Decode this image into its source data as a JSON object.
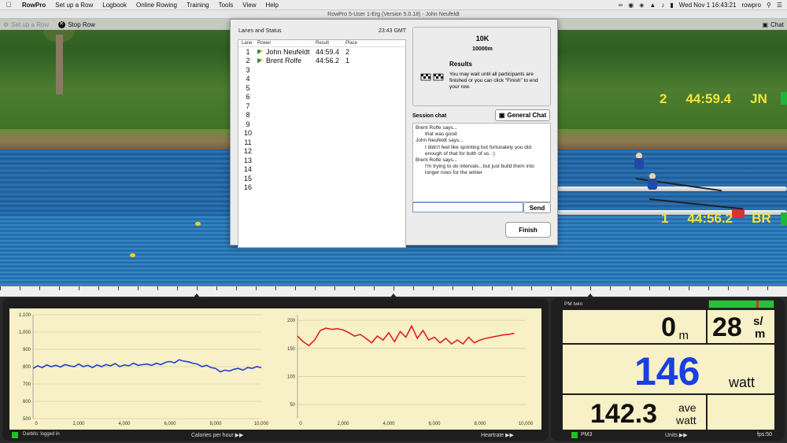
{
  "menubar": {
    "app": "RowPro",
    "items": [
      "Set up a Row",
      "Logbook",
      "Online Rowing",
      "Training",
      "Tools",
      "View",
      "Help"
    ],
    "clock": "Wed Nov 1  16:43:21",
    "user": "rowpro"
  },
  "window": {
    "title": "RowPro 5-User 1-Erg (Version 5.0.18) - John Neufeldt"
  },
  "toolbar": {
    "setup": "Set up a Row",
    "stop": "Stop Row",
    "chat": "Chat"
  },
  "overlay": {
    "lane2": {
      "lane": "2",
      "time": "44:59.4",
      "initials": "JN"
    },
    "lane1": {
      "lane": "1",
      "time": "44:56.2",
      "initials": "BR"
    }
  },
  "dialog": {
    "heading": "Lanes and Status",
    "time": "23:43 GMT",
    "columns": [
      "Lane",
      "Rower",
      "Result",
      "Place"
    ],
    "lanes": [
      {
        "lane": "1",
        "rower": "John Neufeldt",
        "result": "44:59.4",
        "place": "2"
      },
      {
        "lane": "2",
        "rower": "Brent Rolfe",
        "result": "44:56.2",
        "place": "1"
      },
      {
        "lane": "3"
      },
      {
        "lane": "4"
      },
      {
        "lane": "5"
      },
      {
        "lane": "6"
      },
      {
        "lane": "7"
      },
      {
        "lane": "8"
      },
      {
        "lane": "9"
      },
      {
        "lane": "10"
      },
      {
        "lane": "11"
      },
      {
        "lane": "12"
      },
      {
        "lane": "13"
      },
      {
        "lane": "14"
      },
      {
        "lane": "15"
      },
      {
        "lane": "16"
      }
    ],
    "event": "10K",
    "distance": "10000m",
    "results_title": "Results",
    "results_text": "You may wait until all participants are finished or you can click \"Finish\" to end your row.",
    "session_chat_label": "Session chat",
    "general_chat_label": "General Chat",
    "chat": [
      {
        "who": "Brent Rolfe says...",
        "msg": "that was good"
      },
      {
        "who": "John Neufeldt says...",
        "msg": "I didn't feel like sprinting but fortunately you did enough of that for both of us. :)"
      },
      {
        "who": "Brent Rolfe says...",
        "msg": "I'm trying to do intervals...but just build them into longer rows for the winter"
      }
    ],
    "send_label": "Send",
    "finish_label": "Finish"
  },
  "graphs": {
    "darbits": "Darbits: logged in",
    "left_label": "Calories per hour",
    "right_label": "Heartrate",
    "left_y_ticks": [
      "1,100",
      "1,000",
      "900",
      "800",
      "700",
      "600",
      "500"
    ],
    "left_x_ticks": [
      "0",
      "2,000",
      "4,000",
      "6,000",
      "8,000",
      "10,000"
    ],
    "right_y_ticks": [
      "200",
      "150",
      "100",
      "50"
    ],
    "right_x_ticks": [
      "0",
      "2,000",
      "4,000",
      "6,000",
      "8,000",
      "10,000"
    ]
  },
  "chart_data": [
    {
      "type": "line",
      "title": "Calories per hour",
      "x": [
        0,
        200,
        400,
        600,
        800,
        1000,
        1200,
        1400,
        1600,
        1800,
        2000,
        2200,
        2400,
        2600,
        2800,
        3000,
        3200,
        3400,
        3600,
        3800,
        4000,
        4200,
        4400,
        4600,
        4800,
        5000,
        5200,
        5400,
        5600,
        5800,
        6000,
        6200,
        6400,
        6600,
        6800,
        7000,
        7200,
        7400,
        7600,
        7800,
        8000,
        8200,
        8400,
        8600,
        8800,
        9000,
        9200,
        9400,
        9600,
        9800,
        10000
      ],
      "series": [
        {
          "values": [
            790,
            805,
            795,
            810,
            800,
            808,
            798,
            812,
            805,
            800,
            815,
            800,
            808,
            795,
            810,
            800,
            812,
            805,
            818,
            800,
            810,
            805,
            820,
            808,
            812,
            815,
            808,
            820,
            812,
            825,
            830,
            822,
            840,
            832,
            828,
            820,
            815,
            800,
            808,
            795,
            790,
            770,
            780,
            775,
            785,
            790,
            780,
            795,
            790,
            800,
            795
          ],
          "color": "#1f3fd0"
        }
      ],
      "ylim": [
        500,
        1100
      ],
      "xlim": [
        0,
        10000
      ],
      "grid": true
    },
    {
      "type": "line",
      "title": "Heartrate",
      "x": [
        0,
        250,
        500,
        750,
        1000,
        1250,
        1500,
        1750,
        2000,
        2250,
        2500,
        2750,
        3000,
        3250,
        3500,
        3750,
        4000,
        4250,
        4500,
        4750,
        5000,
        5250,
        5500,
        5750,
        6000,
        6250,
        6500,
        6750,
        7000,
        7250,
        7500,
        7750,
        8000,
        8250,
        8500,
        8750,
        9000,
        9250,
        9500
      ],
      "series": [
        {
          "values": [
            172,
            162,
            155,
            165,
            182,
            186,
            184,
            185,
            183,
            178,
            172,
            175,
            168,
            160,
            172,
            165,
            178,
            162,
            180,
            170,
            190,
            168,
            182,
            165,
            170,
            160,
            168,
            158,
            165,
            158,
            170,
            160,
            165,
            168,
            170,
            172,
            174,
            175,
            177
          ],
          "color": "#e02020"
        }
      ],
      "ylim": [
        25,
        210
      ],
      "xlim": [
        0,
        10000
      ],
      "grid": true
    }
  ],
  "pm": {
    "title": "PM twin",
    "distance": "0",
    "distance_unit": "m",
    "spm": "28",
    "spm_unit_top": "s/",
    "spm_unit_bottom": "m",
    "watts": "146",
    "watts_unit": "watt",
    "ave": "142.3",
    "ave_unit_top": "ave",
    "ave_unit_bottom": "watt",
    "monitor": "PM3",
    "units_label": "Units",
    "fps": "fps:50"
  },
  "colors": {
    "watts_blue": "#1a3fe0",
    "overlay_yellow": "#f5e33a",
    "panel_bg": "#f8f0c6"
  }
}
